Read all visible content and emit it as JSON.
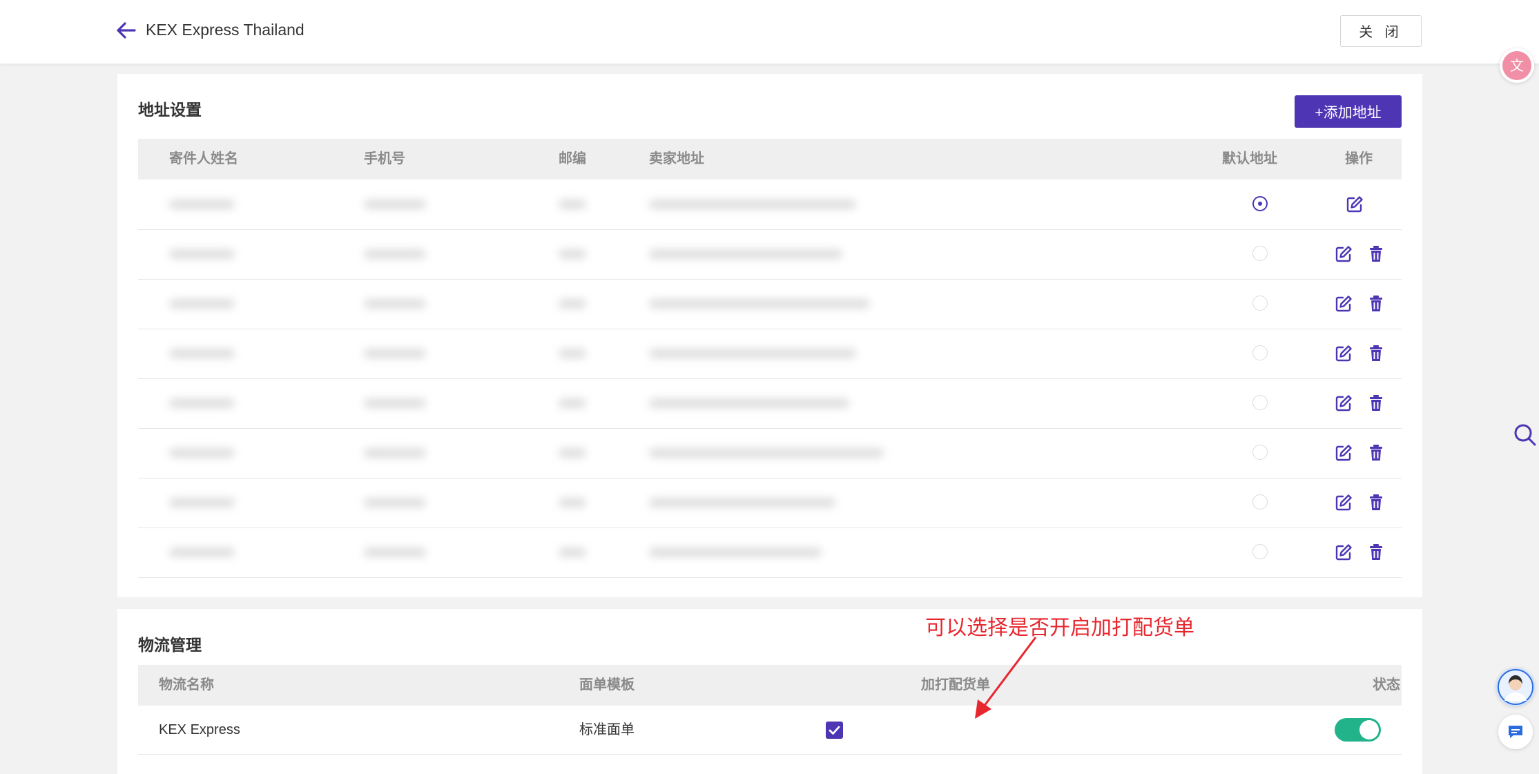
{
  "header": {
    "title": "KEX Express Thailand",
    "close_label": "关 闭"
  },
  "address_section": {
    "title": "地址设置",
    "add_button_label": "+添加地址",
    "columns": {
      "sender_name": "寄件人姓名",
      "phone": "手机号",
      "postcode": "邮编",
      "seller_address": "卖家地址",
      "default_address": "默认地址",
      "actions": "操作"
    },
    "rows": [
      {
        "default": true
      },
      {
        "default": false
      },
      {
        "default": false
      },
      {
        "default": false
      },
      {
        "default": false
      },
      {
        "default": false
      },
      {
        "default": false
      },
      {
        "default": false
      }
    ]
  },
  "logistics_section": {
    "title": "物流管理",
    "columns": {
      "name": "物流名称",
      "template": "面单模板",
      "packing_slip": "加打配货单",
      "status": "状态"
    },
    "rows": [
      {
        "name": "KEX Express",
        "template": "标准面单",
        "packing_slip_checked": true,
        "status_on": true
      }
    ]
  },
  "annotation": {
    "text": "可以选择是否开启加打配货单"
  },
  "colors": {
    "accent": "#4d35b4",
    "toggle_on": "#22b38a",
    "annotation": "#e8262e"
  },
  "icons": [
    "arrow-left-icon",
    "edit-icon",
    "trash-icon",
    "check-icon",
    "translate-icon",
    "search-icon",
    "support-avatar",
    "chat-icon"
  ]
}
